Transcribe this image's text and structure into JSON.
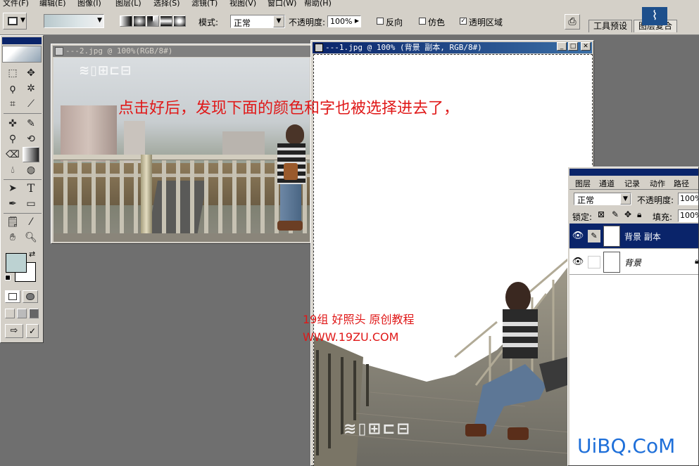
{
  "menu": [
    "文件(F)",
    "编辑(E)",
    "图像(I)",
    "图层(L)",
    "选择(S)",
    "滤镜(T)",
    "视图(V)",
    "窗口(W)",
    "帮助(H)"
  ],
  "options": {
    "mode_label": "模式:",
    "mode_value": "正常",
    "opacity_label": "不透明度:",
    "opacity_value": "100%",
    "reverse_label": "反向",
    "reverse_checked": false,
    "dither_label": "仿色",
    "dither_checked": false,
    "transparency_label": "透明区域",
    "transparency_checked": true,
    "tab_tool_presets": "工具预设",
    "tab_layer_comps": "图层复合"
  },
  "toolbox": {
    "tools": [
      "marquee-tool",
      "move-tool",
      "lasso-tool",
      "magic-wand-tool",
      "crop-tool",
      "slice-tool",
      "healing-brush-tool",
      "brush-tool",
      "stamp-tool",
      "history-brush-tool",
      "eraser-tool",
      "gradient-tool",
      "blur-tool",
      "dodge-tool",
      "path-select-tool",
      "type-tool",
      "pen-tool",
      "shape-tool",
      "notes-tool",
      "eyedropper-tool",
      "hand-tool",
      "zoom-tool"
    ],
    "type_glyph": "T",
    "foreground_color": "#bcd2d2",
    "background_color": "#ffffff"
  },
  "window2": {
    "title": "---2.jpg @ 100%(RGB/8#)"
  },
  "window1": {
    "title": "---1.jpg @ 100% (背景 副本, RGB/8#)"
  },
  "annotation": {
    "main_text": "点击好后，发现下面的颜色和字也被选择进去了，",
    "color": "#e01818"
  },
  "watermark": {
    "line1": "19组     好照头   原创教程",
    "line2": "WWW.19ZU.COM"
  },
  "layers_panel": {
    "tabs": [
      "图层",
      "通道",
      "记录",
      "动作",
      "路径"
    ],
    "blend_mode": "正常",
    "opacity_label": "不透明度:",
    "opacity_value": "100%",
    "lock_label": "锁定:",
    "fill_label": "填充:",
    "fill_value": "100%",
    "layers": [
      {
        "name": "背景 副本",
        "selected": true
      },
      {
        "name": "背景",
        "selected": false
      }
    ]
  },
  "site_logo": "UiBQ.CoM"
}
